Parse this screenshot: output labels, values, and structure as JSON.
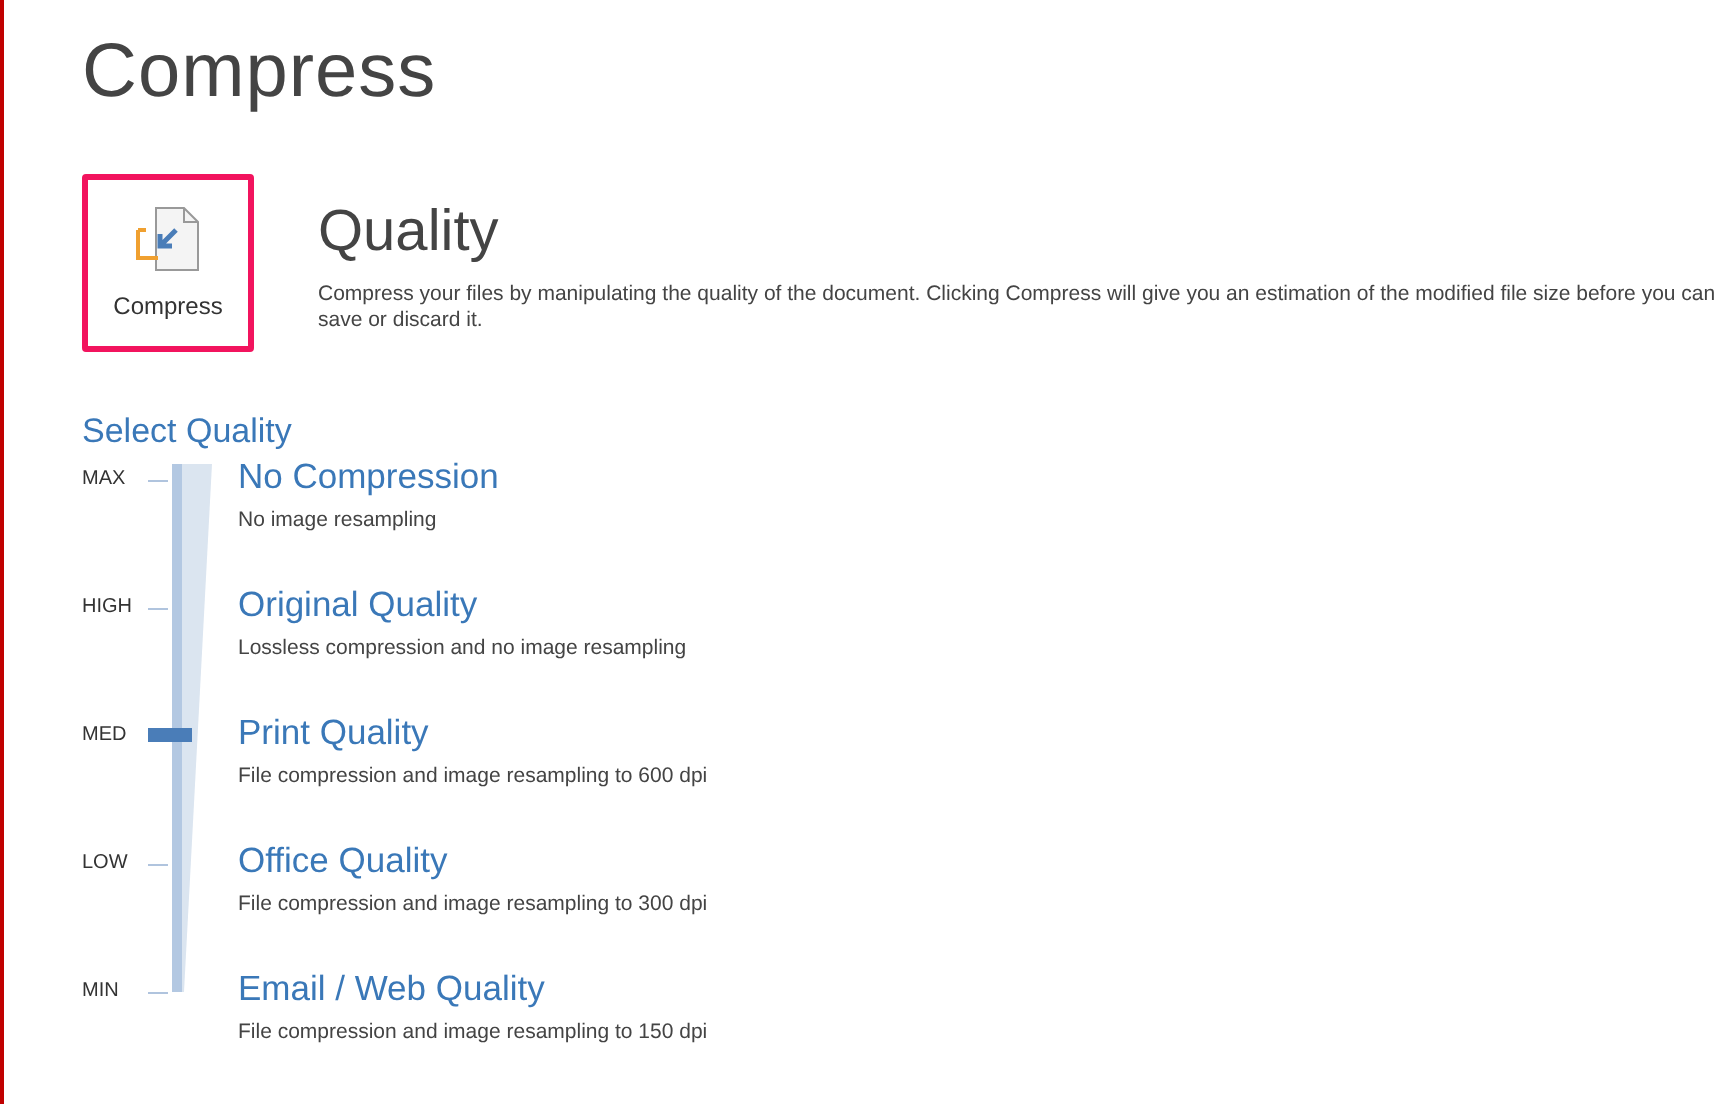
{
  "page_title": "Compress",
  "compress_button": {
    "label": "Compress"
  },
  "section": {
    "title": "Quality",
    "description": "Compress your files by manipulating the quality of the document. Clicking Compress will give you an estimation of the modified file size before you can save or discard it."
  },
  "select_quality": {
    "heading": "Select Quality",
    "options": [
      {
        "level_label": "MAX",
        "title": "No Compression",
        "description": "No image resampling",
        "selected": false
      },
      {
        "level_label": "HIGH",
        "title": "Original Quality",
        "description": "Lossless compression and no image resampling",
        "selected": false
      },
      {
        "level_label": "MED",
        "title": "Print Quality",
        "description": "File compression and image resampling to 600 dpi",
        "selected": true
      },
      {
        "level_label": "LOW",
        "title": "Office Quality",
        "description": "File compression and image resampling to 300 dpi",
        "selected": false
      },
      {
        "level_label": "MIN",
        "title": "Email / Web Quality",
        "description": "File compression and image resampling to 150 dpi",
        "selected": false
      }
    ]
  }
}
